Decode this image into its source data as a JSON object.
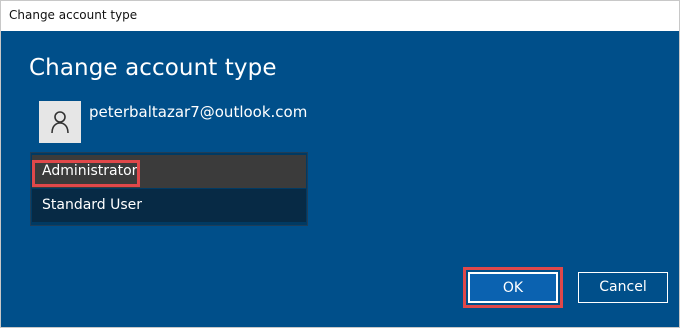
{
  "window": {
    "title": "Change account type"
  },
  "dialog": {
    "heading": "Change account type",
    "user": {
      "email": "peterbaltazar7@outlook.com",
      "avatar_icon": "person-icon"
    },
    "account_types": [
      {
        "label": "Administrator",
        "selected": true
      },
      {
        "label": "Standard User",
        "selected": false
      }
    ],
    "buttons": {
      "ok_label": "OK",
      "cancel_label": "Cancel"
    }
  },
  "colors": {
    "dialog_background": "#004f8a",
    "selected_option": "#3b3b3b",
    "unselected_option": "#072a45",
    "highlight": "#e0484a",
    "ok_button": "#0b62b0"
  }
}
